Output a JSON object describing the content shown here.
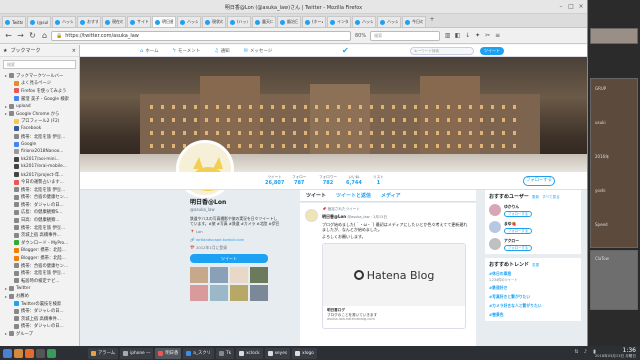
{
  "window": {
    "title": "明日香@Lon (@asuka_law)さん | Twitter - Mozilla Firefox"
  },
  "tabs": [
    {
      "label": "Twitter"
    },
    {
      "label": "(@suka"
    },
    {
      "label": "ハッシュタグ"
    },
    {
      "label": "おすすめ"
    },
    {
      "label": "現在の設定"
    },
    {
      "label": "サイドバー"
    },
    {
      "label": "明日香@"
    },
    {
      "label": "ハッシュタグ"
    },
    {
      "label": "現状の"
    },
    {
      "label": "(ハッシュ"
    },
    {
      "label": "露天ログ"
    },
    {
      "label": "鍛冶日記"
    },
    {
      "label": "(ホーム"
    },
    {
      "label": "インター"
    },
    {
      "label": "ハッシュ"
    },
    {
      "label": "ハッシュ"
    },
    {
      "label": "今日の運勢"
    }
  ],
  "navbar": {
    "url": "https://twitter.com/asuka_law",
    "zoom": "80%",
    "search_placeholder": "検索"
  },
  "sidebar": {
    "title": "ブックマーク",
    "search_placeholder": "検索",
    "items": [
      {
        "label": "ブックマークツールバー",
        "indent": 1,
        "color": "#888"
      },
      {
        "label": "よく見るページ",
        "indent": 2,
        "color": "#e88a2a"
      },
      {
        "label": "Firefox を使ってみよう",
        "indent": 2,
        "color": "#e55"
      },
      {
        "label": "厳澄 美子 - Google 検索",
        "indent": 2,
        "color": "#4285f4"
      },
      {
        "label": "upload",
        "indent": 1,
        "color": "#888"
      },
      {
        "label": "Google Chrome から",
        "indent": 1,
        "color": "#888"
      },
      {
        "label": "プロフィール2 (F2)",
        "indent": 2,
        "color": "#f2c94c"
      },
      {
        "label": "Facebook",
        "indent": 2,
        "color": "#3b5998"
      },
      {
        "label": "携帯：北陸を旅 伊豆...",
        "indent": 2,
        "color": "#888"
      },
      {
        "label": "Google",
        "indent": 2,
        "color": "#4285f4"
      },
      {
        "label": "firionx2018Nanoo...",
        "indent": 2,
        "color": "#999"
      },
      {
        "label": "kk2017/aoi-mini...",
        "indent": 2,
        "color": "#444"
      },
      {
        "label": "kk2017/erai-mobile...",
        "indent": 2,
        "color": "#444"
      },
      {
        "label": "kk2017/project-年...",
        "indent": 2,
        "color": "#444"
      },
      {
        "label": "今日の運勢占います...",
        "indent": 2,
        "color": "#e55"
      },
      {
        "label": "携帯：北陸を旅 伊豆...",
        "indent": 2,
        "color": "#888"
      },
      {
        "label": "携帯：合宿の健康セン...",
        "indent": 2,
        "color": "#888"
      },
      {
        "label": "携帯：ダジャレの日...",
        "indent": 2,
        "color": "#888"
      },
      {
        "label": "広島：の健康観察S...",
        "indent": 2,
        "color": "#888"
      },
      {
        "label": "日高：の健康観察...",
        "indent": 2,
        "color": "#888"
      },
      {
        "label": "携帯：北陸を旅 伊豆...",
        "indent": 2,
        "color": "#888"
      },
      {
        "label": "茨城上宿 高橋事件...",
        "indent": 2,
        "color": "#888"
      },
      {
        "label": "ダウンロード - MyPro...",
        "indent": 2,
        "color": "#3a3"
      },
      {
        "label": "Blogger: 携帯：北陸...",
        "indent": 2,
        "color": "#f57d00"
      },
      {
        "label": "Blogger: 携帯：北陸...",
        "indent": 2,
        "color": "#f57d00"
      },
      {
        "label": "携帯：合宿の健康セン...",
        "indent": 2,
        "color": "#888"
      },
      {
        "label": "携帯：北陸を旅 伊豆...",
        "indent": 2,
        "color": "#888"
      },
      {
        "label": "転居時の検定ナビ...",
        "indent": 2,
        "color": "#888"
      },
      {
        "label": "Twitter",
        "indent": 1,
        "color": "#888"
      },
      {
        "label": "お薦め",
        "indent": 1,
        "color": "#888"
      },
      {
        "label": "Twitterの裏技を検索",
        "indent": 2,
        "color": "#1da1f2"
      },
      {
        "label": "携帯：ダジャレの日...",
        "indent": 2,
        "color": "#888"
      },
      {
        "label": "茨城上宿 高橋事件...",
        "indent": 2,
        "color": "#888"
      },
      {
        "label": "携帯：ダジャレの日...",
        "indent": 2,
        "color": "#888"
      },
      {
        "label": "グループ",
        "indent": 1,
        "color": "#888"
      }
    ]
  },
  "twitter_nav": {
    "home": "ホーム",
    "moments": "モーメント",
    "notifications": "通知",
    "messages": "メッセージ",
    "search_placeholder": "キーワード検索",
    "tweet": "ツイート"
  },
  "profile": {
    "name": "明日香@Lon",
    "handle": "@asuka_law",
    "bio": "鉄道やバスの写真撮影や旅の実況を日々ツイートしています。#旅 #写真 #鉄道 #カメラ #北陸 #伊豆",
    "location": "Lon",
    "site": "wrtlandscape.tumblr.com",
    "joined": "2012年1月に登録",
    "tweet_button": "ツイート",
    "follow_button": "フォローする",
    "photo_colors": [
      "#c8a88a",
      "#8aa0b8",
      "#e8d8c8",
      "#6a7a5a",
      "#d89a9a",
      "#9ab8c8",
      "#b8a868",
      "#7a8898"
    ]
  },
  "stats": [
    {
      "label": "ツイート",
      "value": "26,807"
    },
    {
      "label": "フォロー",
      "value": "787"
    },
    {
      "label": "フォロワー",
      "value": "782"
    },
    {
      "label": "いいね",
      "value": "6,744"
    },
    {
      "label": "リスト",
      "value": "1"
    }
  ],
  "timeline": {
    "tabs": [
      "ツイート",
      "ツイートと返信",
      "メディア"
    ],
    "tweet": {
      "pinned": "固定されたツイート",
      "name": "明日香@Lon",
      "handle": "@asuka_law · 1月13日",
      "text": "ブログ始めました(｀・ω・´) 最初はメディアにしたいとか色々考えてて更新遅れましたが、なんとか始めました。",
      "text2": "よろしくお願いします。",
      "card_title": "明日香ログ",
      "card_desc": "ブログのことを書いていきます",
      "card_url": "asuka-law.hatenablog.com",
      "card_brand": "Hatena Blog"
    }
  },
  "suggestions": {
    "title": "おすすめユーザー",
    "refresh": "更新",
    "see_all": "すべて見る",
    "users": [
      {
        "name": "ゆかりん",
        "follow": "フォローする",
        "color": "#d9a6b8"
      },
      {
        "name": "まゆ🍓",
        "follow": "フォローする",
        "color": "#b8c8e0"
      },
      {
        "name": "アクロー",
        "follow": "フォローする",
        "color": "#c0c0c0"
      }
    ]
  },
  "trends": {
    "title": "おすすめトレンド",
    "change": "変更",
    "items": [
      {
        "tag": "#休日の車窓",
        "sub": "1,234件のツイート"
      },
      {
        "tag": "#鉄道好き",
        "sub": ""
      },
      {
        "tag": "#写真好きと繋がりたい",
        "sub": ""
      },
      {
        "tag": "#カメラ好きな人と繋がりたい",
        "sub": ""
      },
      {
        "tag": "#雪景色",
        "sub": ""
      }
    ]
  },
  "taskbar": {
    "tasks": [
      {
        "label": "アラーム",
        "color": "#e8a33a"
      },
      {
        "label": "iphone —",
        "color": "#aaa"
      },
      {
        "label": "明日香",
        "color": "#e55"
      },
      {
        "label": "a_スクリ",
        "color": "#3a8ee8"
      },
      {
        "label": "Tk",
        "color": "#888"
      },
      {
        "label": "xclock",
        "color": "#ddd"
      },
      {
        "label": "xeyes",
        "color": "#ddd"
      },
      {
        "label": "xlogo",
        "color": "#ddd"
      }
    ],
    "time": "1:36",
    "date": "2018年03月13日 月曜日"
  },
  "desktop": {
    "lines": [
      "GRUP",
      "usuki",
      "2016年",
      "yoshi",
      "Speed",
      "ClaTow"
    ]
  }
}
